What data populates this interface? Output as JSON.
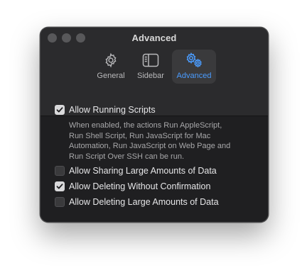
{
  "window": {
    "title": "Advanced"
  },
  "toolbar": {
    "tabs": [
      {
        "label": "General",
        "icon": "gear-icon",
        "selected": false
      },
      {
        "label": "Sidebar",
        "icon": "sidebar-icon",
        "selected": false
      },
      {
        "label": "Advanced",
        "icon": "gears-icon",
        "selected": true
      }
    ]
  },
  "options": {
    "allow_running_scripts": {
      "label": "Allow Running Scripts",
      "checked": true,
      "description_lines": [
        "When enabled, the actions Run AppleScript,",
        "Run Shell Script, Run JavaScript for Mac",
        "Automation, Run JavaScript on Web Page and",
        "Run Script Over SSH can be run."
      ]
    },
    "allow_sharing_large_data": {
      "label": "Allow Sharing Large Amounts of Data",
      "checked": false
    },
    "allow_deleting_without_confirmation": {
      "label": "Allow Deleting Without Confirmation",
      "checked": true
    },
    "allow_deleting_large_data": {
      "label": "Allow Deleting Large Amounts of Data",
      "checked": false
    }
  },
  "colors": {
    "accent": "#4a9cff",
    "window_bg": "#1f1f21",
    "titlebar_bg": "#2b2b2d"
  }
}
